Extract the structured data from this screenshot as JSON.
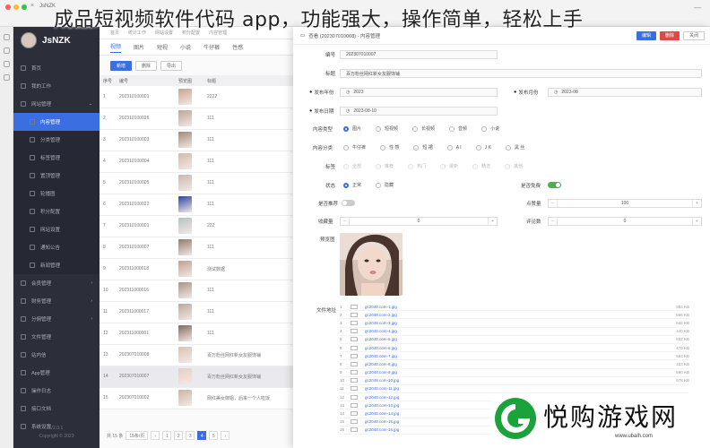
{
  "overlay_title": "成品短视频软件代码 app，功能强大，操作简单，轻松上手",
  "browser": {
    "tab_title": "JsNZK",
    "colors": [
      "#ff5f57",
      "#febc2e",
      "#28c840"
    ]
  },
  "sidebar": {
    "brand": "JsNZK",
    "items": [
      {
        "label": "首页",
        "type": "top"
      },
      {
        "label": "我的工作",
        "type": "top"
      },
      {
        "label": "网站管理",
        "type": "top",
        "caret": "⌄"
      },
      {
        "label": "内容管理",
        "type": "sub",
        "active": true
      },
      {
        "label": "分类管理",
        "type": "sub"
      },
      {
        "label": "标签管理",
        "type": "sub"
      },
      {
        "label": "置顶管理",
        "type": "sub"
      },
      {
        "label": "轮播图",
        "type": "sub"
      },
      {
        "label": "积分配置",
        "type": "sub"
      },
      {
        "label": "网站设置",
        "type": "sub"
      },
      {
        "label": "通知公告",
        "type": "sub"
      },
      {
        "label": "新闻管理",
        "type": "sub"
      },
      {
        "label": "会员管理",
        "type": "top",
        "caret": "›"
      },
      {
        "label": "财务管理",
        "type": "top",
        "caret": "›"
      },
      {
        "label": "分佣管理",
        "type": "top",
        "caret": "›"
      },
      {
        "label": "文件管理",
        "type": "top"
      },
      {
        "label": "站内信",
        "type": "top"
      },
      {
        "label": "App管理",
        "type": "top"
      },
      {
        "label": "操作日志",
        "type": "top"
      },
      {
        "label": "接口文档",
        "type": "top"
      },
      {
        "label": "系统设置",
        "type": "top"
      }
    ],
    "version": "V2.0.1",
    "copyright": "Copyright © 2023"
  },
  "list": {
    "breadcrumbs": [
      "首页",
      "统计工作",
      "网站设置",
      "积分配置",
      "内容管理"
    ],
    "tabs": [
      {
        "label": "视频",
        "active": true
      },
      {
        "label": "图片"
      },
      {
        "label": "短视"
      },
      {
        "label": "小说"
      },
      {
        "label": "牛仔裤"
      },
      {
        "label": "性感"
      }
    ],
    "toolbar": {
      "add": "新增",
      "delete": "删除",
      "export": "导出"
    },
    "columns": [
      "序号",
      "编号",
      "预览图",
      "标题"
    ],
    "rows": [
      {
        "no": "1",
        "code": "202310100001",
        "color": "#caa38f",
        "title": "2222"
      },
      {
        "no": "2",
        "code": "202310100026",
        "color": "#b9a49a",
        "title": "111"
      },
      {
        "no": "3",
        "code": "202310100003",
        "color": "#a08878",
        "title": "111"
      },
      {
        "no": "4",
        "code": "202310100004",
        "color": "#d2b9ac",
        "title": "111"
      },
      {
        "no": "5",
        "code": "202310100005",
        "color": "#c9b8b0",
        "title": "111"
      },
      {
        "no": "6",
        "code": "202310100022",
        "color": "#2b42a8",
        "title": "111"
      },
      {
        "no": "7",
        "code": "202310100001",
        "color": "#b6c2c4",
        "title": "222"
      },
      {
        "no": "8",
        "code": "202310100007",
        "color": "#8e7a70",
        "title": "111"
      },
      {
        "no": "9",
        "code": "202311000018",
        "color": "#c0a090",
        "title": "测试数据"
      },
      {
        "no": "10",
        "code": "202311000016",
        "color": "#a89488",
        "title": "111"
      },
      {
        "no": "11",
        "code": "202311000017",
        "color": "#b9a8a0",
        "title": "111"
      },
      {
        "no": "12",
        "code": "202311000001",
        "color": "#7c6a60",
        "title": "111"
      },
      {
        "no": "13",
        "code": "202307010008",
        "color": "#d9c2b6",
        "title": "百万粉丝网红新女友服饰铺"
      },
      {
        "no": "14",
        "code": "202307010007",
        "color": "#e5cdc3",
        "title": "百万粉丝网红新女友服饰铺",
        "highlight": true
      },
      {
        "no": "15",
        "code": "202307010002",
        "color": "#cbb4a8",
        "title": "网红美女御姐，后来一个人吃饭"
      }
    ],
    "pager": {
      "total": "共 15 条",
      "per_page": "15条/页",
      "pages": [
        "1",
        "2",
        "3",
        "4",
        "5"
      ],
      "current": "4"
    }
  },
  "modal": {
    "title": "查看 (202307010008) - 内容管理",
    "btn_edit": "编辑",
    "btn_delete": "删除",
    "btn_close": "关闭",
    "fields": {
      "code_label": "编号",
      "code": "202307010007",
      "title_label": "标题",
      "title": "百万粉丝网红新女友服饰铺",
      "year_label": "发布年份",
      "year": "2023",
      "month_label": "发布月份",
      "month": "2023-08",
      "date_label": "发布日期",
      "date": "2023-08-10",
      "type_label": "内容类型",
      "types": [
        {
          "label": "图片",
          "on": true
        },
        {
          "label": "短视频"
        },
        {
          "label": "长视频"
        },
        {
          "label": "音频"
        },
        {
          "label": "小说"
        }
      ],
      "cat_label": "内容分类",
      "cats": [
        {
          "label": "牛仔裤"
        },
        {
          "label": "性 感"
        },
        {
          "label": "短 裙"
        },
        {
          "label": "A I"
        },
        {
          "label": "J K"
        },
        {
          "label": "黑 丝"
        }
      ],
      "tag_label": "标签",
      "tags": [
        "全部",
        "推荐",
        "热门",
        "最新",
        "精选",
        "其他"
      ],
      "status_label": "状态",
      "status": [
        {
          "label": "正常",
          "on": true
        },
        {
          "label": "隐藏"
        }
      ],
      "free_label": "是否免费",
      "rec_label": "是否推荐",
      "likes_label": "点赞量",
      "likes": "100",
      "fav_label": "收藏量",
      "fav": "0",
      "comm_label": "评论数",
      "comm": "0",
      "preview_label": "预览图",
      "file_label": "文件地址",
      "files": [
        {
          "n": "1",
          "url": "gc2048.com-1.jpg",
          "size": "884 KB"
        },
        {
          "n": "2",
          "url": "gc2048.com-2.jpg",
          "size": "666 KB"
        },
        {
          "n": "3",
          "url": "gc2048.com-3.jpg",
          "size": "642 KB"
        },
        {
          "n": "4",
          "url": "gc2048.com-4.jpg",
          "size": "440 KB"
        },
        {
          "n": "5",
          "url": "gc2048.com-5.jpg",
          "size": "652 KB"
        },
        {
          "n": "6",
          "url": "gc2048.com-6.jpg",
          "size": "470 KB"
        },
        {
          "n": "7",
          "url": "gc2048.com-7.jpg",
          "size": "564 KB"
        },
        {
          "n": "8",
          "url": "gc2048.com-8.jpg",
          "size": "153 KB"
        },
        {
          "n": "9",
          "url": "gc2048.com-9.jpg",
          "size": "590 KB"
        },
        {
          "n": "10",
          "url": "gc2048.com-10.jpg",
          "size": "678 KB"
        },
        {
          "n": "11",
          "url": "gc2048.com-11.jpg",
          "size": ""
        },
        {
          "n": "12",
          "url": "gc2048.com-12.jpg",
          "size": ""
        },
        {
          "n": "13",
          "url": "gc2048.com-13.jpg",
          "size": ""
        },
        {
          "n": "14",
          "url": "gc2048.com-14.jpg",
          "size": ""
        },
        {
          "n": "15",
          "url": "gc2048.com-15.jpg",
          "size": ""
        },
        {
          "n": "16",
          "url": "gc2048.com-16.jpg",
          "size": ""
        }
      ]
    }
  },
  "logo": {
    "text": "悦购游戏网",
    "url": "www.ubalh.com",
    "color": "#1aa33a"
  },
  "colors": {
    "accent": "#3b6ee0",
    "sidebar": "#2c2f3a",
    "danger": "#e04848",
    "success": "#4caf50"
  }
}
